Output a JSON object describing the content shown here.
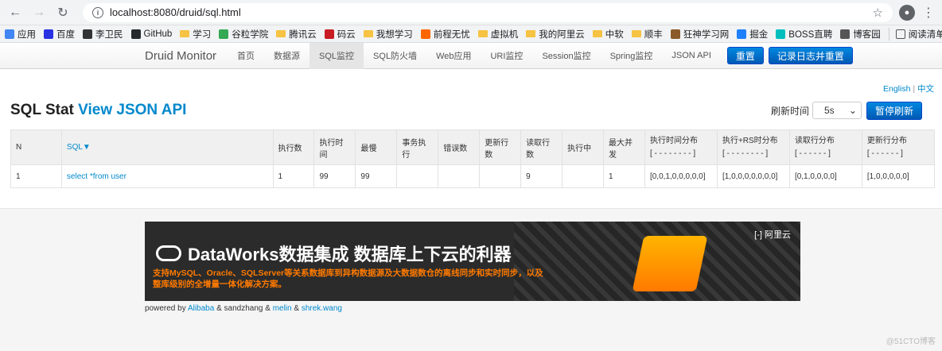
{
  "browser": {
    "url": "localhost:8080/druid/sql.html",
    "bookmarks": [
      {
        "label": "应用",
        "icon": "apps-grid-icon",
        "color": "#4285f4"
      },
      {
        "label": "百度",
        "icon": "baidu-icon",
        "color": "#2932e1"
      },
      {
        "label": "李卫民",
        "icon": "gear-icon",
        "color": "#333333"
      },
      {
        "label": "GitHub",
        "icon": "github-icon",
        "color": "#24292e"
      },
      {
        "label": "学习",
        "icon": "folder-icon",
        "color": "#f6c342"
      },
      {
        "label": "谷粒学院",
        "icon": "guli-icon",
        "color": "#34a853"
      },
      {
        "label": "腾讯云",
        "icon": "folder-icon",
        "color": "#f6c342"
      },
      {
        "label": "码云",
        "icon": "gitee-icon",
        "color": "#c71d23"
      },
      {
        "label": "我想学习",
        "icon": "folder-icon",
        "color": "#f6c342"
      },
      {
        "label": "前程无忧",
        "icon": "51job-icon",
        "color": "#ff6600"
      },
      {
        "label": "虚拟机",
        "icon": "folder-icon",
        "color": "#f6c342"
      },
      {
        "label": "我的阿里云",
        "icon": "folder-icon",
        "color": "#f6c342"
      },
      {
        "label": "中软",
        "icon": "folder-icon",
        "color": "#f6c342"
      },
      {
        "label": "顺丰",
        "icon": "folder-icon",
        "color": "#f6c342"
      },
      {
        "label": "狂神学习网",
        "icon": "kuangshen-icon",
        "color": "#8a5a2b"
      },
      {
        "label": "掘金",
        "icon": "juejin-icon",
        "color": "#1e80ff"
      },
      {
        "label": "BOSS直聘",
        "icon": "boss-icon",
        "color": "#00bebd"
      },
      {
        "label": "博客园",
        "icon": "cnblogs-icon",
        "color": "#555555"
      }
    ],
    "reading_list": "阅读清单"
  },
  "nav": {
    "brand": "Druid Monitor",
    "items": [
      {
        "label": "首页",
        "active": false
      },
      {
        "label": "数据源",
        "active": false
      },
      {
        "label": "SQL监控",
        "active": true
      },
      {
        "label": "SQL防火墙",
        "active": false
      },
      {
        "label": "Web应用",
        "active": false
      },
      {
        "label": "URI监控",
        "active": false
      },
      {
        "label": "Session监控",
        "active": false
      },
      {
        "label": "Spring监控",
        "active": false
      },
      {
        "label": "JSON API",
        "active": false
      }
    ],
    "reset_label": "重置",
    "log_reset_label": "记录日志并重置"
  },
  "lang": {
    "english": "English",
    "sep": " | ",
    "chinese": "中文"
  },
  "page": {
    "title": "SQL Stat",
    "json_link": "View JSON API",
    "refresh_label": "刷新时间",
    "refresh_value": "5s",
    "pause_label": "暂停刷新"
  },
  "table": {
    "headers": [
      {
        "label": "N"
      },
      {
        "label": "SQL▼",
        "link": true
      },
      {
        "label": "执行数"
      },
      {
        "label": "执行时间"
      },
      {
        "label": "最慢"
      },
      {
        "label": "事务执行"
      },
      {
        "label": "错误数"
      },
      {
        "label": "更新行数"
      },
      {
        "label": "读取行数"
      },
      {
        "label": "执行中"
      },
      {
        "label": "最大并发"
      },
      {
        "label": "执行时间分布",
        "sub": "[ - - - - - - - - ]"
      },
      {
        "label": "执行+RS时分布",
        "sub": "[ - - - - - - - - ]"
      },
      {
        "label": "读取行分布",
        "sub": "[ - - - - - - ]"
      },
      {
        "label": "更新行分布",
        "sub": "[ - - - - - - ]"
      }
    ],
    "rows": [
      [
        "1",
        "select *from user",
        "1",
        "99",
        "99",
        "",
        "",
        "",
        "9",
        "",
        "1",
        "[0,0,1,0,0,0,0,0]",
        "[1,0,0,0,0,0,0,0]",
        "[0,1,0,0,0,0]",
        "[1,0,0,0,0,0]"
      ]
    ]
  },
  "banner": {
    "title": "DataWorks数据集成 数据库上下云的利器",
    "subtitle": "支持MySQL、Oracle、SQLServer等关系数据库到异构数据源及大数据数仓的离线同步和实时同步，以及整库级别的全增量一体化解决方案。",
    "brand": "阿里云"
  },
  "footer": {
    "powered_by": "powered by",
    "alibaba": "Alibaba",
    "amp1": " & sandzhang & ",
    "melin": "melin",
    "amp2": " & ",
    "shrek": "shrek.wang"
  },
  "watermark": "@51CTO博客"
}
